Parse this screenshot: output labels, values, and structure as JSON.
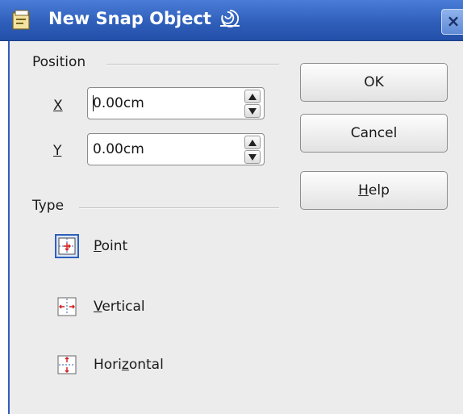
{
  "window": {
    "title": "New Snap Object",
    "close_label": "×"
  },
  "position": {
    "group_label": "Position",
    "x": {
      "label": "X",
      "value": "0.00cm"
    },
    "y": {
      "label": "Y",
      "value": "0.00cm"
    }
  },
  "type": {
    "group_label": "Type",
    "options": [
      {
        "prefix": "",
        "accel": "P",
        "suffix": "oint",
        "selected": true
      },
      {
        "prefix": "",
        "accel": "V",
        "suffix": "ertical",
        "selected": false
      },
      {
        "prefix": "Hori",
        "accel": "z",
        "suffix": "ontal",
        "selected": false
      }
    ]
  },
  "buttons": {
    "ok": "OK",
    "cancel": "Cancel",
    "help_accel": "H",
    "help_rest": "elp"
  },
  "colors": {
    "titlebar": "#2f5fba",
    "dialog_bg": "#ececec",
    "icon_red": "#d11c1c",
    "icon_blue": "#2f5fba"
  }
}
